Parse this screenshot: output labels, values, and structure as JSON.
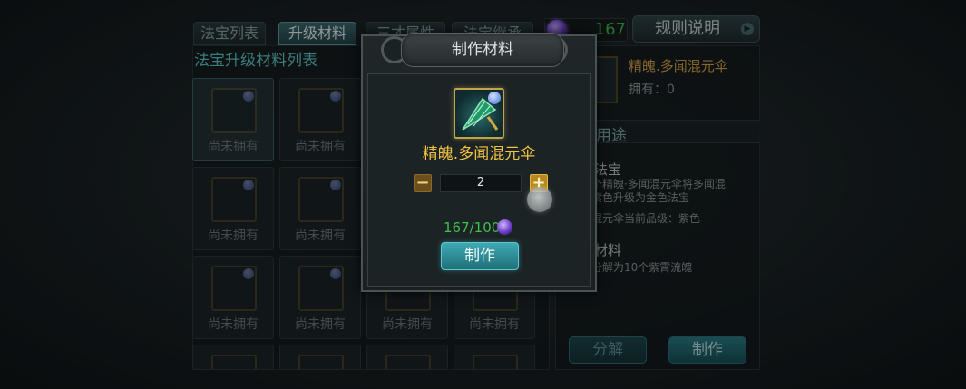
{
  "tabs": [
    {
      "label": "法宝列表"
    },
    {
      "label": "升级材料"
    },
    {
      "label": "三才属性"
    },
    {
      "label": "法宝继承"
    }
  ],
  "currency": {
    "value": "167",
    "icon": "purple-gem-icon"
  },
  "rules_button": {
    "label": "规则说明"
  },
  "list": {
    "title": "法宝升级材料列表",
    "cells": [
      {
        "label": "尚未拥有"
      },
      {
        "label": "尚未拥有"
      },
      {
        "label": "尚未拥有"
      },
      {
        "label": "尚未拥有"
      },
      {
        "label": "尚未拥有"
      },
      {
        "label": "尚未拥有"
      },
      {
        "label": "尚未拥有"
      },
      {
        "label": "尚未拥有"
      }
    ]
  },
  "detail": {
    "name": "精魄.多闻混元伞",
    "owned": "拥有：0",
    "usage_heading": "用途",
    "section1_title": "法宝",
    "section1_lines": [
      "个精魄·多闻混元伞将多闻混",
      "紫色升级为金色法宝",
      "混元伞当前品级：紫色"
    ],
    "section2_title": "材料",
    "section2_lines": [
      "分解为10个紫霄流魄"
    ],
    "decompose_label": "分解",
    "craft_label": "制作"
  },
  "modal": {
    "title": "制作材料",
    "item_name": "精魄.多闻混元伞",
    "quantity": "2",
    "minus": "−",
    "plus": "+",
    "cost": "167/100",
    "make_label": "制作"
  },
  "colors": {
    "accent_teal": "#5fc9cc",
    "gold": "#f0c240",
    "green": "#3fbf4c"
  }
}
